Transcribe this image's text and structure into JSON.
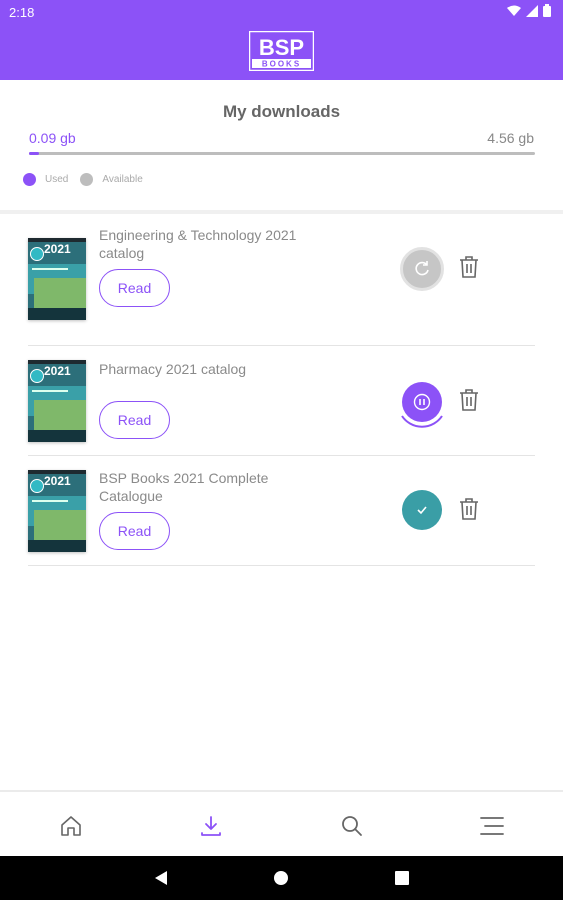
{
  "status_bar": {
    "time": "2:18",
    "icons": [
      "wifi-icon",
      "signal-icon",
      "battery-icon"
    ]
  },
  "header": {
    "logo_text": "BSP",
    "logo_subtext": "BOOKS",
    "accent": "#8c52f7"
  },
  "downloads": {
    "title": "My downloads",
    "used": "0.09 gb",
    "available": "4.56 gb",
    "used_fraction": 0.02,
    "legend_used": "Used",
    "legend_available": "Available",
    "used_color": "#8c52f7",
    "available_color": "#bdbdbd"
  },
  "items": [
    {
      "title": "Engineering & Technology 2021 catalog",
      "read_label": "Read",
      "state": "retry",
      "status_icon": "refresh-icon",
      "delete_icon": "trash-icon",
      "cover_year": "2021"
    },
    {
      "title": "Pharmacy 2021 catalog",
      "read_label": "Read",
      "state": "paused",
      "status_icon": "pause-icon",
      "delete_icon": "trash-icon",
      "cover_year": "2021"
    },
    {
      "title": "BSP Books 2021 Complete Catalogue",
      "read_label": "Read",
      "state": "downloaded",
      "status_icon": "check-icon",
      "delete_icon": "trash-icon",
      "cover_year": "2021"
    }
  ],
  "bottom_nav": {
    "items": [
      {
        "name": "home",
        "icon": "home-icon",
        "active": false
      },
      {
        "name": "downloads",
        "icon": "download-icon",
        "active": true
      },
      {
        "name": "search",
        "icon": "search-icon",
        "active": false
      },
      {
        "name": "menu",
        "icon": "menu-icon",
        "active": false
      }
    ]
  },
  "system_nav": [
    "back-icon",
    "home-circle-icon",
    "recents-icon"
  ]
}
